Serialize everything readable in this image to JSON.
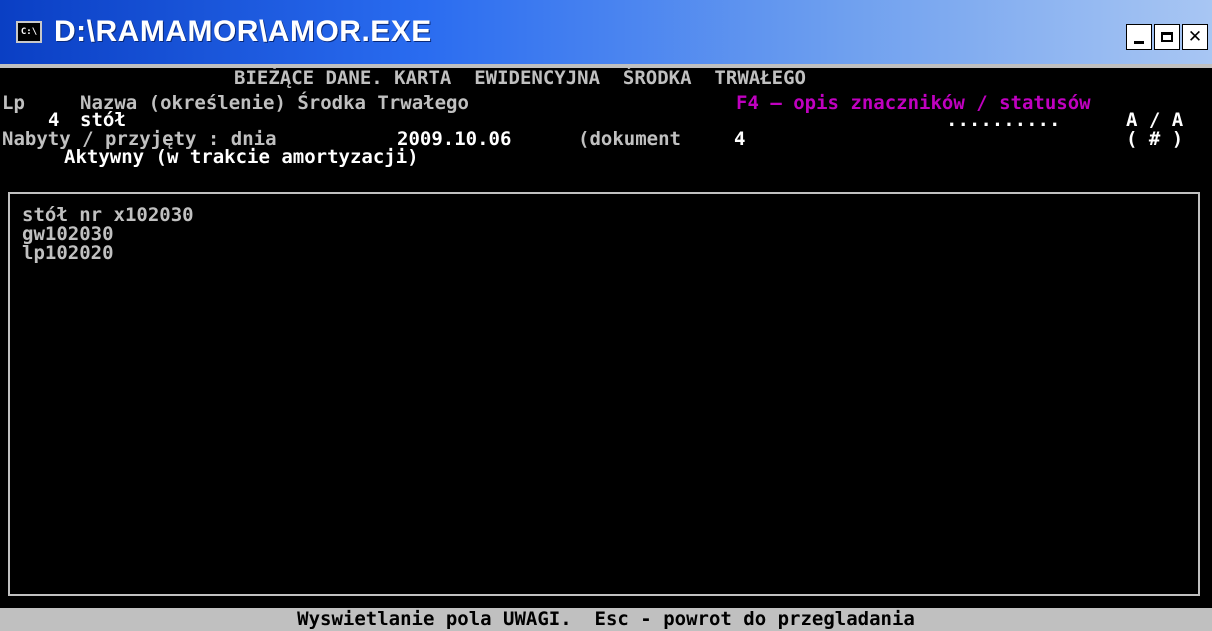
{
  "window": {
    "title": "D:\\RAMAMOR\\AMOR.EXE",
    "icon": "console-icon",
    "icon_label": "C:\\"
  },
  "header": {
    "title": "BIEŻĄCE DANE. KARTA  EWIDENCYJNA  ŚRODKA  TRWAŁEGO"
  },
  "columns": {
    "lp_label": "Lp",
    "name_label": "Nazwa (określenie) Środka Trwałego",
    "f4_hint": "F4 – opis znaczników / statusów"
  },
  "record": {
    "lp": "4",
    "name": "stół",
    "flags_dots": "..........",
    "flags_status": "A / A",
    "acquired_label": "Nabyty / przyjęty : dnia",
    "acquired_date": "2009.10.06",
    "document_label": "(dokument",
    "document_number": "4",
    "marker": "( # )",
    "status": "Aktywny (w trakcie amortyzacji)"
  },
  "notes": {
    "lines": [
      "stół nr x102030",
      "gw102030",
      "lp102020"
    ]
  },
  "statusbar": {
    "text": "Wyswietlanie pola UWAGI.  Esc - powrot do przegladania"
  }
}
